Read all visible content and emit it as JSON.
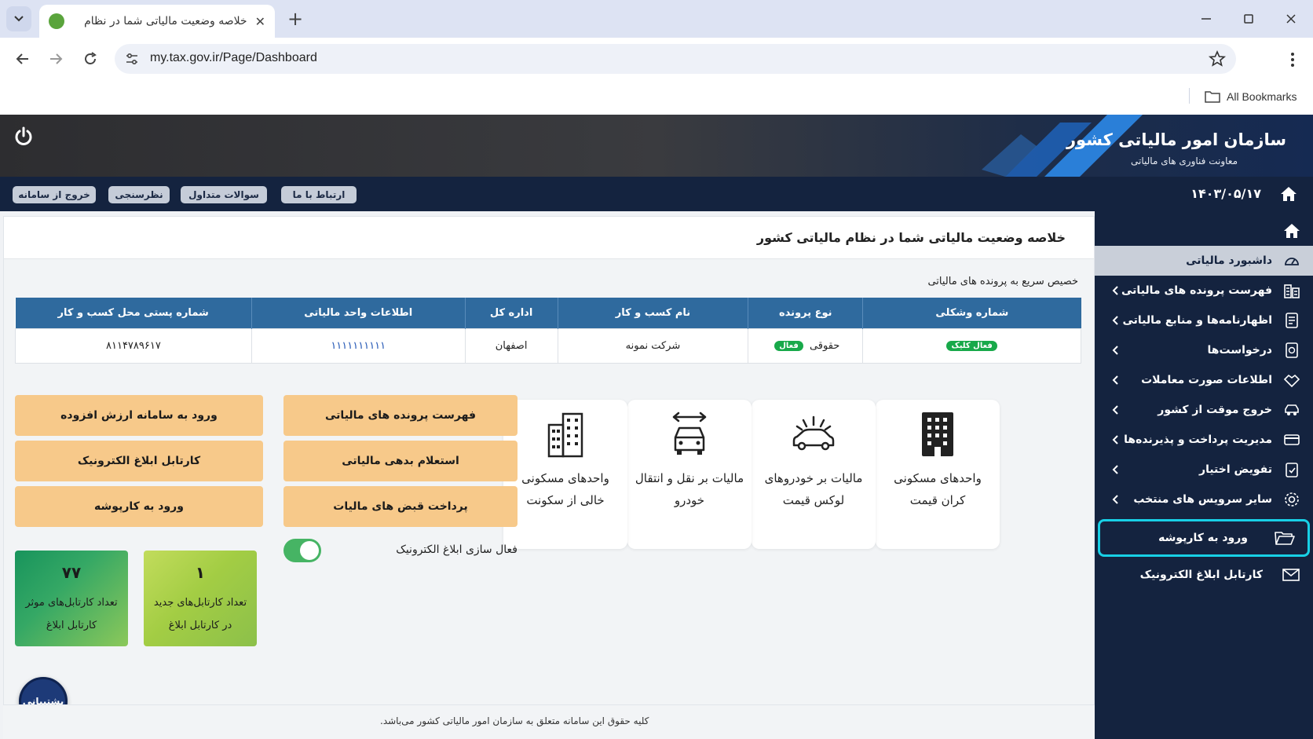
{
  "browser": {
    "tab_title": "خلاصه وضعیت مالیاتی شما در نظام",
    "url": "my.tax.gov.ir/Page/Dashboard",
    "bookmarks_label": "All Bookmarks"
  },
  "header": {
    "org_name": "سازمان امور مالیاتی کشور",
    "org_sub": "معاونت فناوری های مالیاتی",
    "date": "۱۴۰۳/۰۵/۱۷",
    "buttons": {
      "contact": "ارتباط با ما",
      "faq": "سوالات متداول",
      "survey": "نظرسنجی",
      "logout": "خروج از سامانه"
    }
  },
  "sidebar": {
    "items": [
      {
        "label": "داشبورد مالیاتی"
      },
      {
        "label": "فهرست پرونده های مالیاتی"
      },
      {
        "label": "اظهارنامه‌ها و منابع مالیاتی"
      },
      {
        "label": "درخواست‌ها"
      },
      {
        "label": "اطلاعات صورت معاملات"
      },
      {
        "label": "خروج موقت از کشور"
      },
      {
        "label": "مدیریت پرداخت و پذیرنده‌ها"
      },
      {
        "label": "تفویض اختیار"
      },
      {
        "label": "سایر سرویس های منتخب"
      }
    ],
    "kartpooshe": "ورود به کارپوشه",
    "cartable": "کارتابل ابلاغ الکترونیک"
  },
  "main": {
    "title": "خلاصه وضعیت مالیاتی شما در نظام مالیاتی کشور",
    "quick_label": "خصیص سریع به پرونده های مالیاتی",
    "table": {
      "headers": [
        "شماره وشکلی",
        "نوع پرونده",
        "نام کسب و کار",
        "اداره کل",
        "اطلاعات واحد مالیاتی",
        "شماره پستی محل کسب و کار"
      ],
      "row": {
        "status_badge": "فعال کلیک",
        "type": "حقوقی",
        "type_badge": "فعال",
        "business": "شرکت نمونه",
        "office": "اصفهان",
        "unit_info": "۱۱۱۱۱۱۱۱۱۱",
        "postal": "۸۱۱۴۷۸۹۶۱۷"
      }
    },
    "cards": [
      {
        "label": "واحدهای مسکونی کران قیمت",
        "icon": "building-icon"
      },
      {
        "label": "مالیات بر خودروهای لوکس قیمت",
        "icon": "luxury-car-icon"
      },
      {
        "label": "مالیات بر نقل و انتقال خودرو",
        "icon": "car-transfer-icon"
      },
      {
        "label": "واحدهای مسکونی خالی از سکونت",
        "icon": "apartment-icon"
      }
    ],
    "actions": {
      "case_list": "فهرست پرونده های مالیاتی",
      "debt_inquiry": "استعلام بدهی مالیاتی",
      "pay_bills": "پرداخت قبض های مالیات",
      "vat_login": "ورود به سامانه ارزش افزوده",
      "cartable": "کارتابل ابلاغ الکترونیک",
      "kartpooshe": "ورود به  کارپوشه"
    },
    "toggle_label": "فعال سازی ابلاغ الکترونیک",
    "kpis": [
      {
        "value": "۱",
        "label": "تعداد کارتابل‌های جدید در کارتابل ابلاغ",
        "color": "#a5cf45"
      },
      {
        "value": "۷۷",
        "label": "تعداد کارتابل‌های موثر کارتابل ابلاغ",
        "color": "#2ea363"
      }
    ]
  },
  "support_label": "پشتیبانی",
  "footer_text": "کلیه حقوق این سامانه متعلق به سازمان امور مالیاتی کشور می‌باشد."
}
